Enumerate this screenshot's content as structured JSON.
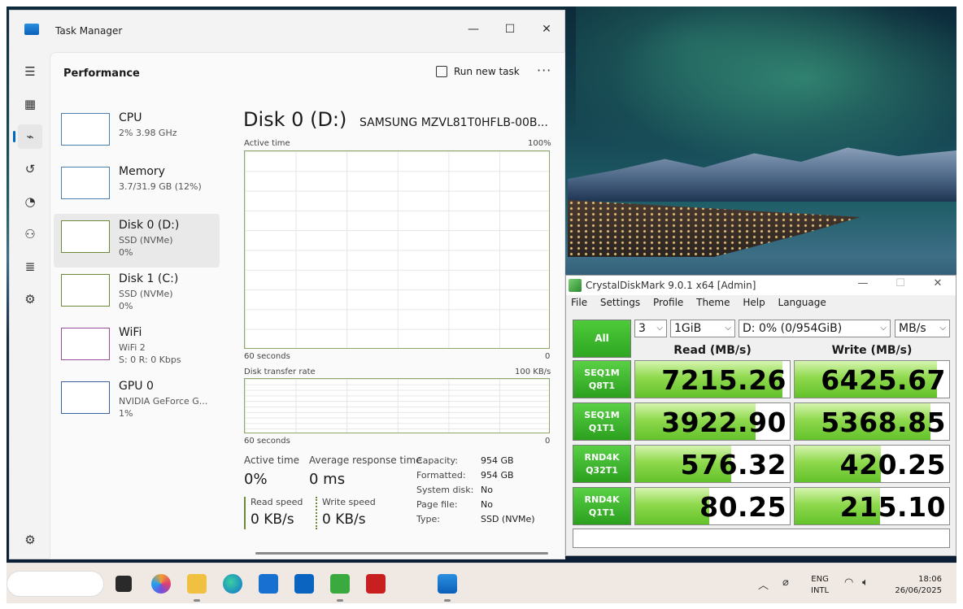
{
  "taskmanager": {
    "title": "Task Manager",
    "page_title": "Performance",
    "run_new_task": "Run new task",
    "resources": [
      {
        "name": "CPU",
        "line1": "2%  3.98 GHz",
        "line2": ""
      },
      {
        "name": "Memory",
        "line1": "3.7/31.9 GB (12%)",
        "line2": ""
      },
      {
        "name": "Disk 0 (D:)",
        "line1": "SSD (NVMe)",
        "line2": "0%"
      },
      {
        "name": "Disk 1 (C:)",
        "line1": "SSD (NVMe)",
        "line2": "0%"
      },
      {
        "name": "WiFi",
        "line1": "WiFi 2",
        "line2": "S: 0 R: 0 Kbps"
      },
      {
        "name": "GPU 0",
        "line1": "NVIDIA GeForce G...",
        "line2": "1%"
      }
    ],
    "detail": {
      "title": "Disk 0 (D:)",
      "model": "SAMSUNG MZVL81T0HFLB-00B...",
      "active_time_label": "Active time",
      "active_time_max": "100%",
      "seconds_label": "60 seconds",
      "zero": "0",
      "transfer_label": "Disk transfer rate",
      "transfer_max": "100 KB/s",
      "stats": {
        "active_time": {
          "label": "Active time",
          "value": "0%"
        },
        "avg_response": {
          "label": "Average response time",
          "value": "0 ms"
        },
        "read_speed": {
          "label": "Read speed",
          "value": "0 KB/s"
        },
        "write_speed": {
          "label": "Write speed",
          "value": "0 KB/s"
        }
      },
      "props": [
        {
          "k": "Capacity:",
          "v": "954 GB"
        },
        {
          "k": "Formatted:",
          "v": "954 GB"
        },
        {
          "k": "System disk:",
          "v": "No"
        },
        {
          "k": "Page file:",
          "v": "No"
        },
        {
          "k": "Type:",
          "v": "SSD (NVMe)"
        }
      ]
    }
  },
  "cdm": {
    "title": "CrystalDiskMark 9.0.1 x64 [Admin]",
    "menu": [
      "File",
      "Settings",
      "Profile",
      "Theme",
      "Help",
      "Language"
    ],
    "all_label": "All",
    "count": "3",
    "size": "1GiB",
    "drive": "D: 0% (0/954GiB)",
    "unit": "MB/s",
    "read_header": "Read (MB/s)",
    "write_header": "Write (MB/s)",
    "tests": [
      {
        "l1": "SEQ1M",
        "l2": "Q8T1",
        "read": "7215.26",
        "write": "6425.67",
        "read_fill": 0.95,
        "write_fill": 0.92
      },
      {
        "l1": "SEQ1M",
        "l2": "Q1T1",
        "read": "3922.90",
        "write": "5368.85",
        "read_fill": 0.78,
        "write_fill": 0.88
      },
      {
        "l1": "RND4K",
        "l2": "Q32T1",
        "read": "576.32",
        "write": "420.25",
        "read_fill": 0.62,
        "write_fill": 0.56
      },
      {
        "l1": "RND4K",
        "l2": "Q1T1",
        "read": "80.25",
        "write": "215.10",
        "read_fill": 0.48,
        "write_fill": 0.55
      }
    ]
  },
  "taskbar": {
    "lang_top": "ENG",
    "lang_bottom": "INTL",
    "time": "18:06",
    "date": "26/06/2025"
  }
}
